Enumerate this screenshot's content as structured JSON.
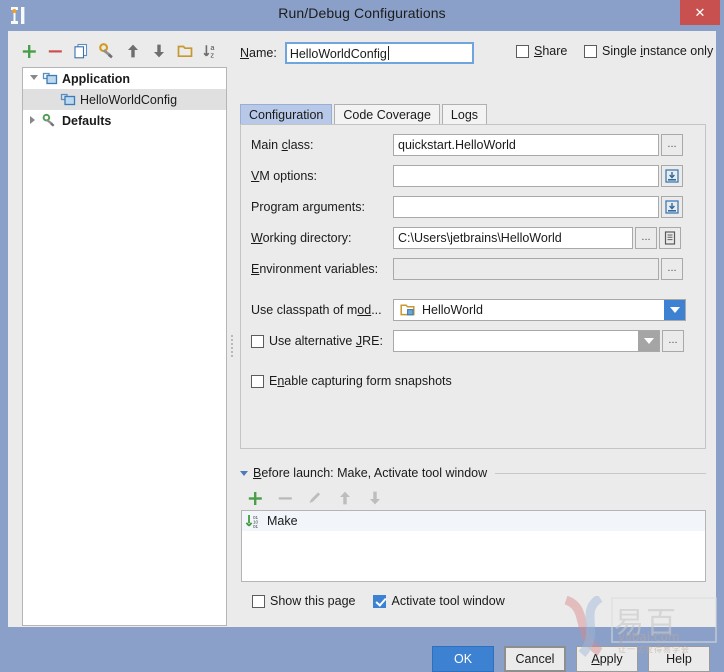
{
  "window": {
    "title": "Run/Debug Configurations",
    "logo_icon": "intellij-idea-logo-icon",
    "close_label": "✕"
  },
  "left_toolbar": {
    "items": [
      {
        "icon": "add-icon",
        "label": "+"
      },
      {
        "icon": "remove-icon",
        "label": "−"
      },
      {
        "icon": "copy-configuration-icon",
        "label": ""
      },
      {
        "icon": "edit-defaults-wrench-icon",
        "label": ""
      },
      {
        "icon": "move-up-icon",
        "label": ""
      },
      {
        "icon": "move-down-icon",
        "label": ""
      },
      {
        "icon": "create-folder-icon",
        "label": ""
      },
      {
        "icon": "sort-alphabetically-icon",
        "label": ""
      }
    ]
  },
  "tree": {
    "nodes": [
      {
        "label": "Application",
        "icon": "application-config-icon",
        "expanded": true,
        "bold": true,
        "selected": false,
        "indent": 0,
        "twisty": "down"
      },
      {
        "label": "HelloWorldConfig",
        "icon": "application-config-icon",
        "expanded": false,
        "bold": false,
        "selected": true,
        "indent": 1,
        "twisty": "none"
      },
      {
        "label": "Defaults",
        "icon": "defaults-wrench-icon",
        "expanded": false,
        "bold": true,
        "selected": false,
        "indent": 0,
        "twisty": "right"
      }
    ]
  },
  "name_field": {
    "label": "Name:",
    "label_mnemonic": "N",
    "value": "HelloWorldConfig",
    "placeholder": ""
  },
  "header_checkboxes": [
    {
      "label": "Share",
      "mnemonic": "S",
      "checked": false
    },
    {
      "label": "Single instance only",
      "mnemonic": "i",
      "checked": false
    }
  ],
  "tabs": [
    {
      "label": "Configuration",
      "active": true
    },
    {
      "label": "Code Coverage",
      "active": false
    },
    {
      "label": "Logs",
      "active": false
    }
  ],
  "config_fields": {
    "main_class": {
      "label": "Main class:",
      "value": "quickstart.HelloWorld",
      "browse_label": "...",
      "browse_icon": "ellipsis-browse-icon"
    },
    "vm_options": {
      "label": "VM options:",
      "value": "",
      "expand_icon": "expand-editor-icon"
    },
    "program_arguments": {
      "label": "Program arguments:",
      "value": "",
      "expand_icon": "expand-editor-icon"
    },
    "working_directory": {
      "label": "Working directory:",
      "value": "C:\\Users\\jetbrains\\HelloWorld",
      "browse_label": "...",
      "browse_icon": "ellipsis-browse-icon",
      "macro_icon": "insert-macro-icon"
    },
    "environment_variables": {
      "label": "Environment variables:",
      "value": "",
      "browse_label": "...",
      "browse_icon": "ellipsis-browse-icon"
    },
    "use_classpath_of_module": {
      "label": "Use classpath of mod...",
      "value": "HelloWorld",
      "module_icon": "module-folder-icon",
      "arrow_state": "enabled"
    },
    "use_alternative_jre": {
      "label": "Use alternative JRE:",
      "mnemonic": "J",
      "checked": false,
      "value": "",
      "browse_label": "...",
      "browse_icon": "ellipsis-browse-icon",
      "arrow_state": "disabled"
    },
    "enable_capturing_form_snapshots": {
      "label": "Enable capturing form snapshots",
      "mnemonic": "n",
      "checked": false
    }
  },
  "before_launch": {
    "title": "Before launch: Make, Activate tool window",
    "toolbar": [
      {
        "icon": "add-task-icon",
        "enabled": true
      },
      {
        "icon": "remove-task-icon",
        "enabled": false
      },
      {
        "icon": "edit-task-pencil-icon",
        "enabled": false
      },
      {
        "icon": "move-task-up-icon",
        "enabled": false
      },
      {
        "icon": "move-task-down-icon",
        "enabled": false
      }
    ],
    "items": [
      {
        "label": "Make",
        "icon": "compile-make-icon"
      }
    ],
    "checkboxes": [
      {
        "label": "Show this page",
        "checked": false
      },
      {
        "label": "Activate tool window",
        "checked": true
      }
    ]
  },
  "dialog_buttons": [
    {
      "label": "OK",
      "style": "primary"
    },
    {
      "label": "Cancel",
      "style": "default-focus"
    },
    {
      "label": "Apply",
      "style": "default",
      "mnemonic": "A"
    },
    {
      "label": "Help",
      "style": "default"
    }
  ],
  "watermark": {
    "logo_text": "易百",
    "domain": "yiibai.com",
    "tagline": "让一切变得易学会"
  },
  "colors": {
    "title_bar": "#8aa0c8",
    "panel_bg": "#ebebeb",
    "accent_blue": "#3c81d2",
    "close_red": "#c8504f",
    "tab_active": "#b8c8e8",
    "tree_selected": "#e0e0e0"
  }
}
